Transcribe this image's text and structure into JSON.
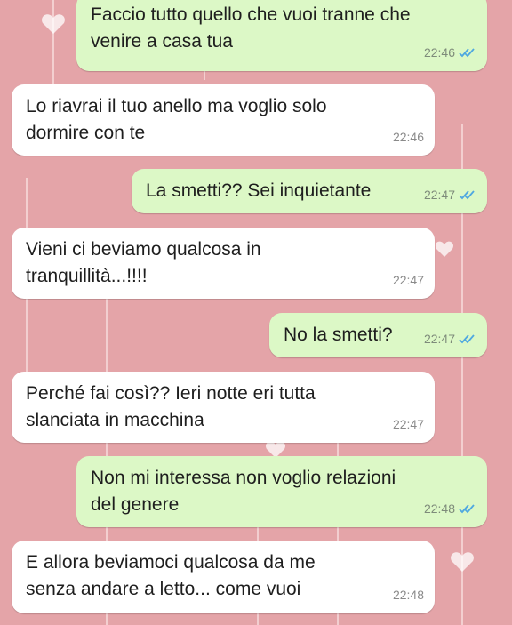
{
  "messages": [
    {
      "direction": "out",
      "text": "Faccio tutto quello che vuoi tranne che\nvenire a casa tua",
      "time": "22:46",
      "status_icon": "double-check-read-icon"
    },
    {
      "direction": "in",
      "text": "Lo riavrai il tuo anello ma voglio solo\ndormire con te",
      "time": "22:46"
    },
    {
      "direction": "out",
      "text": "La smetti?? Sei inquietante",
      "time": "22:47",
      "status_icon": "double-check-read-icon"
    },
    {
      "direction": "in",
      "text": "Vieni ci beviamo qualcosa in\ntranquillità...!!!!",
      "time": "22:47"
    },
    {
      "direction": "out",
      "text": "No la smetti?",
      "time": "22:47",
      "status_icon": "double-check-read-icon"
    },
    {
      "direction": "in",
      "text": "Perché fai così?? Ieri notte eri tutta\nslanciata in macchina",
      "time": "22:47"
    },
    {
      "direction": "out",
      "text": "Non mi interessa non voglio relazioni\ndel genere",
      "time": "22:48",
      "status_icon": "double-check-read-icon"
    },
    {
      "direction": "in",
      "text": "E allora beviamoci qualcosa da me\nsenza andare a letto... come vuoi",
      "time": "22:48"
    }
  ],
  "colors": {
    "background": "#e4a4a8",
    "outgoing_bubble": "#dcf8c6",
    "incoming_bubble": "#ffffff",
    "read_tick": "#4fa8e0"
  }
}
